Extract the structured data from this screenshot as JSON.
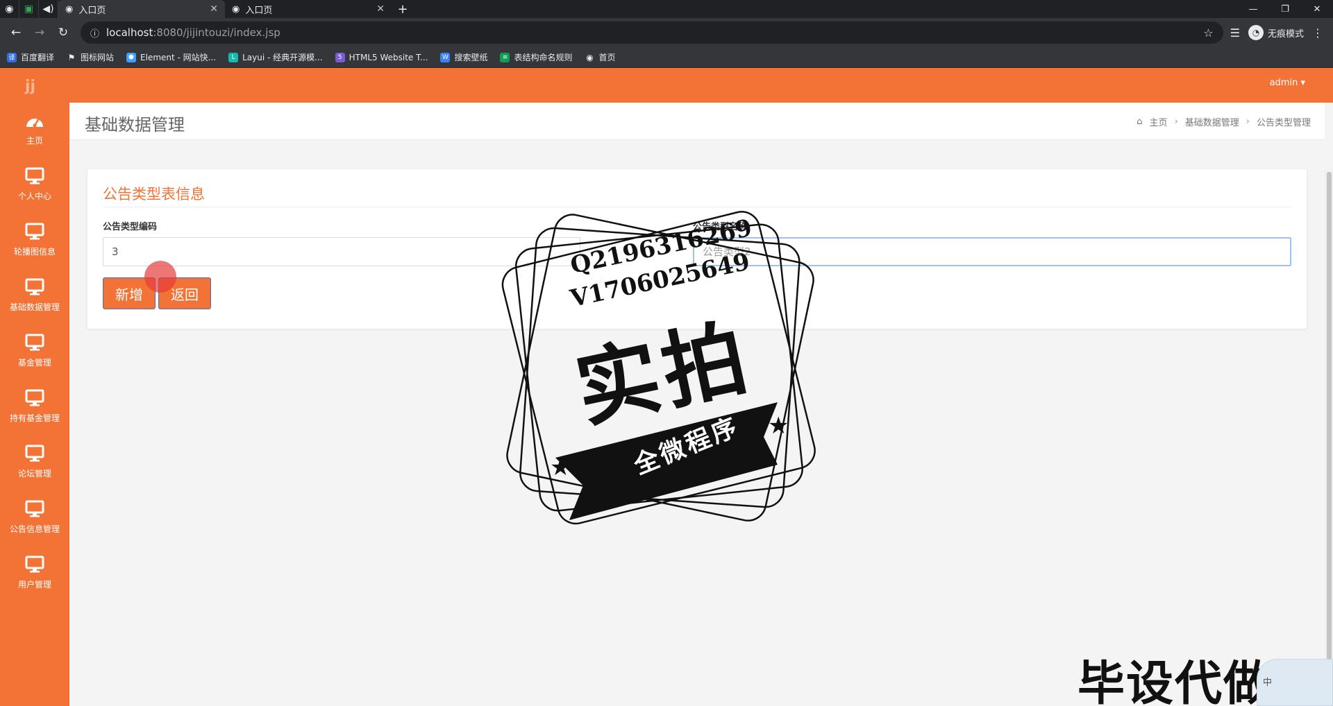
{
  "browser": {
    "tabs": [
      {
        "title": "入口页",
        "active": true
      },
      {
        "title": "入口页",
        "active": false
      }
    ],
    "url_host": "localhost",
    "url_path": ":8080/jijintouzi/index.jsp",
    "incognito_label": "无痕模式",
    "bookmarks": [
      {
        "label": "百度翻译",
        "color": "#2f6de1",
        "glyph": "译"
      },
      {
        "label": "图标网站",
        "color": "#e8eaed",
        "glyph": "⚑"
      },
      {
        "label": "Element - 网站快...",
        "color": "#409eff",
        "glyph": "⬢"
      },
      {
        "label": "Layui - 经典开源模...",
        "color": "#16baaa",
        "glyph": "L"
      },
      {
        "label": "HTML5 Website T...",
        "color": "#7b5cd6",
        "glyph": "5"
      },
      {
        "label": "搜索壁纸",
        "color": "#3b82f6",
        "glyph": "W"
      },
      {
        "label": "表结构命名规则",
        "color": "#0f9d58",
        "glyph": "≡"
      },
      {
        "label": "首页",
        "color": "#e8eaed",
        "glyph": "◉"
      }
    ]
  },
  "app": {
    "logo": "jj",
    "user_menu": "admin ▾",
    "accent_color": "#f27335",
    "sidebar": [
      {
        "label": "主页",
        "icon": "dashboard-icon"
      },
      {
        "label": "个人中心",
        "icon": "monitor-icon"
      },
      {
        "label": "轮播图信息",
        "icon": "monitor-icon"
      },
      {
        "label": "基础数据管理",
        "icon": "monitor-icon"
      },
      {
        "label": "基金管理",
        "icon": "monitor-icon"
      },
      {
        "label": "持有基金管理",
        "icon": "monitor-icon"
      },
      {
        "label": "论坛管理",
        "icon": "monitor-icon"
      },
      {
        "label": "公告信息管理",
        "icon": "monitor-icon"
      },
      {
        "label": "用户管理",
        "icon": "monitor-icon"
      }
    ],
    "page_title": "基础数据管理",
    "breadcrumb": [
      "主页",
      "基础数据管理",
      "公告类型管理"
    ],
    "panel_title": "公告类型表信息",
    "form": {
      "code_label": "公告类型编码",
      "code_value": "3",
      "name_label": "公告类型名称",
      "name_placeholder": "公告类型2",
      "add_button": "新增",
      "back_button": "返回"
    }
  },
  "watermark": {
    "line1": "Q2196316269",
    "line2": "V1706025649",
    "big": "实拍",
    "ribbon": "全微程序",
    "corner": "毕设代做",
    "corner_badge": "中"
  }
}
